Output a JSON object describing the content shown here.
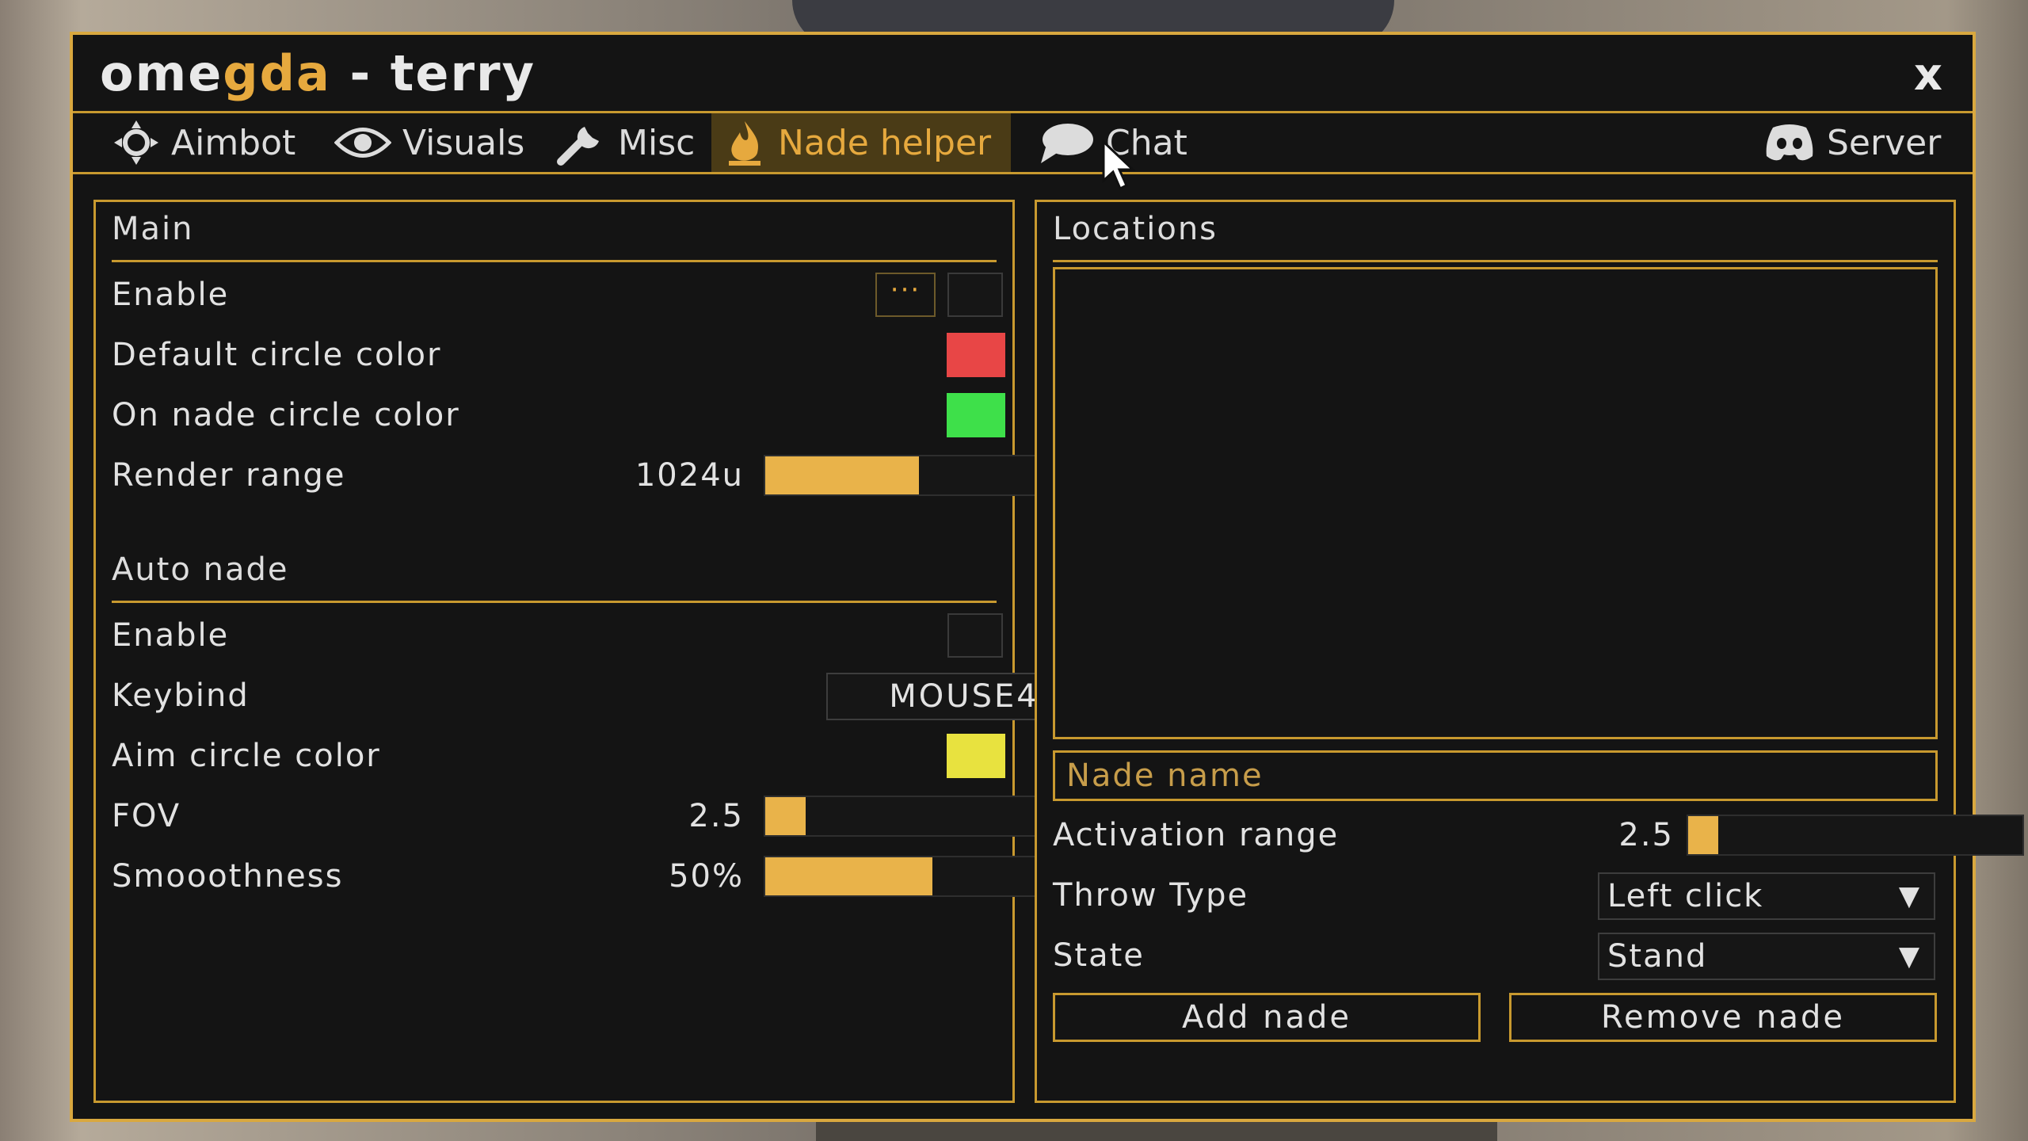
{
  "window": {
    "title_part1": "ome",
    "title_accent": "gda",
    "title_part2": " - terry",
    "close_label": "x"
  },
  "tabs": [
    {
      "label": "Aimbot",
      "icon": "crosshair-icon"
    },
    {
      "label": "Visuals",
      "icon": "eye-icon"
    },
    {
      "label": "Misc",
      "icon": "wrench-icon"
    },
    {
      "label": "Nade helper",
      "icon": "flame-icon",
      "active": true
    },
    {
      "label": "Chat",
      "icon": "chat-bubble-icon"
    },
    {
      "label": "Server",
      "icon": "discord-icon"
    }
  ],
  "main": {
    "title": "Main",
    "enable_label": "Enable",
    "enable_dots": "···",
    "enable_checked": false,
    "default_circle_label": "Default circle color",
    "default_circle_color": "#e84646",
    "on_nade_circle_label": "On nade circle color",
    "on_nade_circle_color": "#3ee04a",
    "render_range_label": "Render range",
    "render_range_value": "1024u",
    "render_range_fraction": 0.46
  },
  "auto_nade": {
    "title": "Auto nade",
    "enable_label": "Enable",
    "enable_checked": false,
    "keybind_label": "Keybind",
    "keybind_value": "MOUSE4",
    "aim_circle_label": "Aim circle color",
    "aim_circle_color": "#e8e23f",
    "fov_label": "FOV",
    "fov_value": "2.5",
    "fov_fraction": 0.12,
    "smoothness_label": "Smooothness",
    "smoothness_value": "50%",
    "smoothness_fraction": 0.5
  },
  "locations": {
    "title": "Locations",
    "name_placeholder": "Nade name",
    "activation_label": "Activation range",
    "activation_value": "2.5",
    "activation_fraction": 0.09,
    "throw_type_label": "Throw Type",
    "throw_type_value": "Left click",
    "state_label": "State",
    "state_value": "Stand",
    "add_button": "Add nade",
    "remove_button": "Remove nade"
  },
  "colors": {
    "accent": "#e6a93e",
    "border": "#c8992f",
    "background": "#141414"
  }
}
